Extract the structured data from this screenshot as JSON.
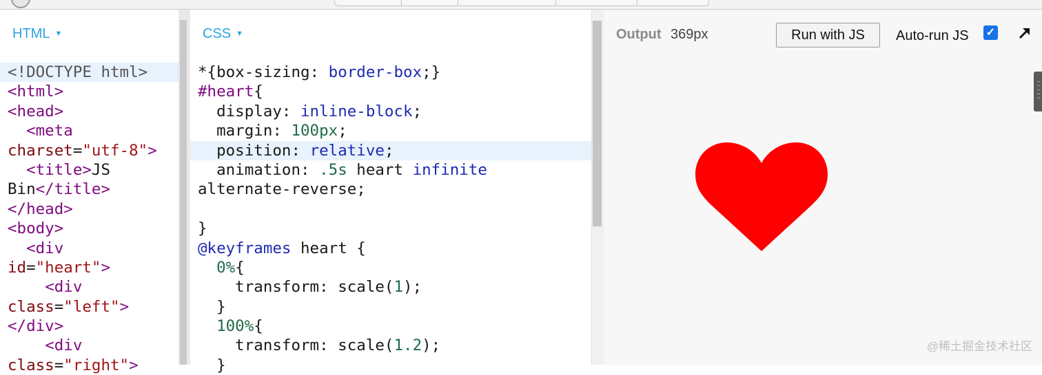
{
  "html_panel": {
    "label": "HTML",
    "lines": [
      [
        {
          "t": "doctype",
          "v": "<!DOCTYPE html>"
        }
      ],
      [
        {
          "t": "tag",
          "v": "<html>"
        }
      ],
      [
        {
          "t": "tag",
          "v": "<head>"
        }
      ],
      [
        {
          "t": "plain",
          "v": "  "
        },
        {
          "t": "tag",
          "v": "<meta"
        }
      ],
      [
        {
          "t": "attr",
          "v": "charset"
        },
        {
          "t": "plain",
          "v": "="
        },
        {
          "t": "str",
          "v": "\"utf-8\""
        },
        {
          "t": "tag",
          "v": ">"
        }
      ],
      [
        {
          "t": "plain",
          "v": "  "
        },
        {
          "t": "tag",
          "v": "<title>"
        },
        {
          "t": "plain",
          "v": "JS"
        }
      ],
      [
        {
          "t": "plain",
          "v": "Bin"
        },
        {
          "t": "tag",
          "v": "</title>"
        }
      ],
      [
        {
          "t": "tag",
          "v": "</head>"
        }
      ],
      [
        {
          "t": "tag",
          "v": "<body>"
        }
      ],
      [
        {
          "t": "plain",
          "v": "  "
        },
        {
          "t": "tag",
          "v": "<div"
        }
      ],
      [
        {
          "t": "attr",
          "v": "id"
        },
        {
          "t": "plain",
          "v": "="
        },
        {
          "t": "str",
          "v": "\"heart\""
        },
        {
          "t": "tag",
          "v": ">"
        }
      ],
      [
        {
          "t": "plain",
          "v": "    "
        },
        {
          "t": "tag",
          "v": "<div"
        }
      ],
      [
        {
          "t": "attr",
          "v": "class"
        },
        {
          "t": "plain",
          "v": "="
        },
        {
          "t": "str",
          "v": "\"left\""
        },
        {
          "t": "tag",
          "v": ">"
        }
      ],
      [
        {
          "t": "tag",
          "v": "</div>"
        }
      ],
      [
        {
          "t": "plain",
          "v": "    "
        },
        {
          "t": "tag",
          "v": "<div"
        }
      ],
      [
        {
          "t": "attr",
          "v": "class"
        },
        {
          "t": "plain",
          "v": "="
        },
        {
          "t": "str",
          "v": "\"right\""
        },
        {
          "t": "tag",
          "v": ">"
        }
      ]
    ],
    "active_line": 0
  },
  "css_panel": {
    "label": "CSS",
    "lines": [
      [
        {
          "t": "plain",
          "v": "*{box-sizing: "
        },
        {
          "t": "kw",
          "v": "border-box"
        },
        {
          "t": "plain",
          "v": ";}"
        }
      ],
      [
        {
          "t": "tag",
          "v": "#heart"
        },
        {
          "t": "plain",
          "v": "{"
        }
      ],
      [
        {
          "t": "plain",
          "v": "  display: "
        },
        {
          "t": "kw",
          "v": "inline-block"
        },
        {
          "t": "plain",
          "v": ";"
        }
      ],
      [
        {
          "t": "plain",
          "v": "  margin: "
        },
        {
          "t": "num",
          "v": "100px"
        },
        {
          "t": "plain",
          "v": ";"
        }
      ],
      [
        {
          "t": "plain",
          "v": "  position: "
        },
        {
          "t": "kw",
          "v": "relative"
        },
        {
          "t": "plain",
          "v": ";"
        }
      ],
      [
        {
          "t": "plain",
          "v": "  animation: "
        },
        {
          "t": "num",
          "v": ".5s"
        },
        {
          "t": "plain",
          "v": " heart "
        },
        {
          "t": "kw",
          "v": "infinite"
        }
      ],
      [
        {
          "t": "plain",
          "v": "alternate-reverse;"
        }
      ],
      [
        {
          "t": "plain",
          "v": ""
        }
      ],
      [
        {
          "t": "plain",
          "v": "}"
        }
      ],
      [
        {
          "t": "atrule",
          "v": "@keyframes"
        },
        {
          "t": "plain",
          "v": " heart {"
        }
      ],
      [
        {
          "t": "plain",
          "v": "  "
        },
        {
          "t": "num",
          "v": "0%"
        },
        {
          "t": "plain",
          "v": "{"
        }
      ],
      [
        {
          "t": "plain",
          "v": "    transform: scale("
        },
        {
          "t": "num",
          "v": "1"
        },
        {
          "t": "plain",
          "v": ");"
        }
      ],
      [
        {
          "t": "plain",
          "v": "  }"
        }
      ],
      [
        {
          "t": "plain",
          "v": "  "
        },
        {
          "t": "num",
          "v": "100%"
        },
        {
          "t": "plain",
          "v": "{"
        }
      ],
      [
        {
          "t": "plain",
          "v": "    transform: scale("
        },
        {
          "t": "num",
          "v": "1.2"
        },
        {
          "t": "plain",
          "v": ");"
        }
      ],
      [
        {
          "t": "plain",
          "v": "  }"
        }
      ]
    ],
    "active_line": 4
  },
  "output_panel": {
    "title": "Output",
    "width_readout": "369px",
    "run_button_label": "Run with JS",
    "autorun_label": "Auto-run JS",
    "autorun_checked": true,
    "heart_color": "#ff0000",
    "expand_icon": "expand-arrow-icon"
  },
  "watermark": "@稀土掘金技术社区"
}
